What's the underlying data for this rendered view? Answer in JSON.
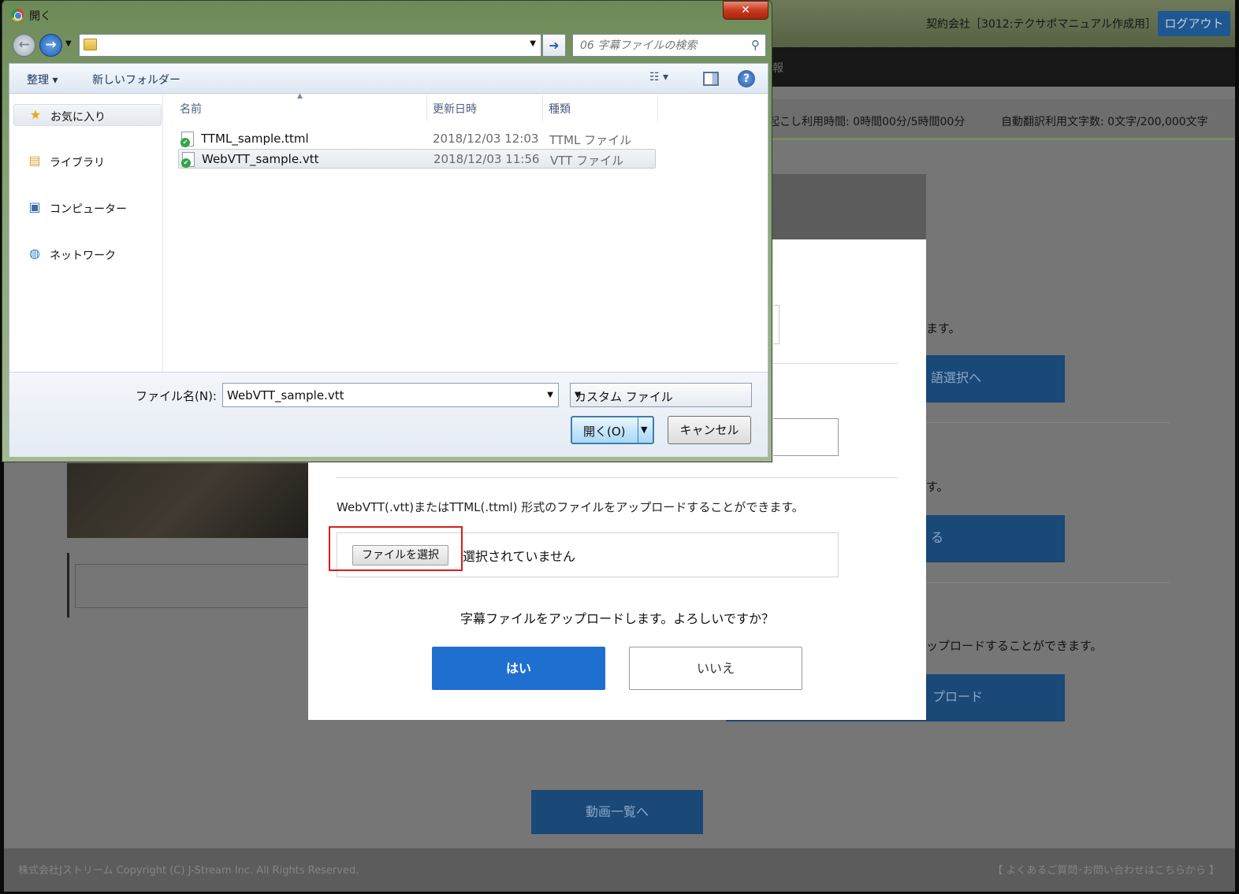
{
  "window": {
    "title": "開く",
    "close_label": "✕"
  },
  "address": {
    "search_placeholder": "06 字幕ファイルの検索"
  },
  "toolbar": {
    "organize_label": "整理 ▾",
    "new_folder_label": "新しいフォルダー",
    "view_icon_label": "☷ ▾",
    "help_label": "?"
  },
  "sidebar": {
    "items": [
      {
        "label": "お気に入り",
        "icon": "star-icon"
      },
      {
        "label": "ライブラリ",
        "icon": "library-icon"
      },
      {
        "label": "コンピューター",
        "icon": "computer-icon"
      },
      {
        "label": "ネットワーク",
        "icon": "network-icon"
      }
    ]
  },
  "columns": {
    "name": "名前",
    "date": "更新日時",
    "type": "種類"
  },
  "files": [
    {
      "name": "TTML_sample.ttml",
      "date": "2018/12/03 12:03",
      "type": "TTML ファイル",
      "selected": false
    },
    {
      "name": "WebVTT_sample.vtt",
      "date": "2018/12/03 11:56",
      "type": "VTT ファイル",
      "selected": true
    }
  ],
  "bottom": {
    "filename_label": "ファイル名(N):",
    "filename_value": "WebVTT_sample.vtt",
    "filetype_value": "カスタム ファイル",
    "open_label": "開く(O)",
    "cancel_label": "キャンセル"
  },
  "modal": {
    "description": "WebVTT(.vtt)またはTTML(.ttml) 形式のファイルをアップロードすることができます。",
    "choose_file_label": "ファイルを選択",
    "no_file_text": "選択されていません",
    "confirm_text": "字幕ファイルをアップロードします。よろしいですか？",
    "yes_label": "はい",
    "no_label": "いいえ"
  },
  "background": {
    "contract_text": "契約会社［3012:テクサポマニュアル作成用］",
    "logout_label": "ログアウト",
    "nav_fragment": "報",
    "usage_left": "起こし利用時間: 0時間00分/5時間00分",
    "usage_right": "自動翻訳利用文字数: 0文字/200,000文字",
    "frag_1": "ます。",
    "btn_1": "語選択へ",
    "frag_2": "す。",
    "btn_2": "る",
    "frag_3": "ップロードすることができます。",
    "btn_3": "プロード",
    "list_button": "動画一覧へ",
    "footer_left": "株式会社Jストリーム Copyright (C) J-Stream Inc. All Rights Reserved.",
    "footer_right": "【 よくあるご質問･お問い合わせはこちらから 】"
  },
  "colors": {
    "highlight_border": "#d91d1d",
    "primary_button": "#1f6fd0"
  }
}
